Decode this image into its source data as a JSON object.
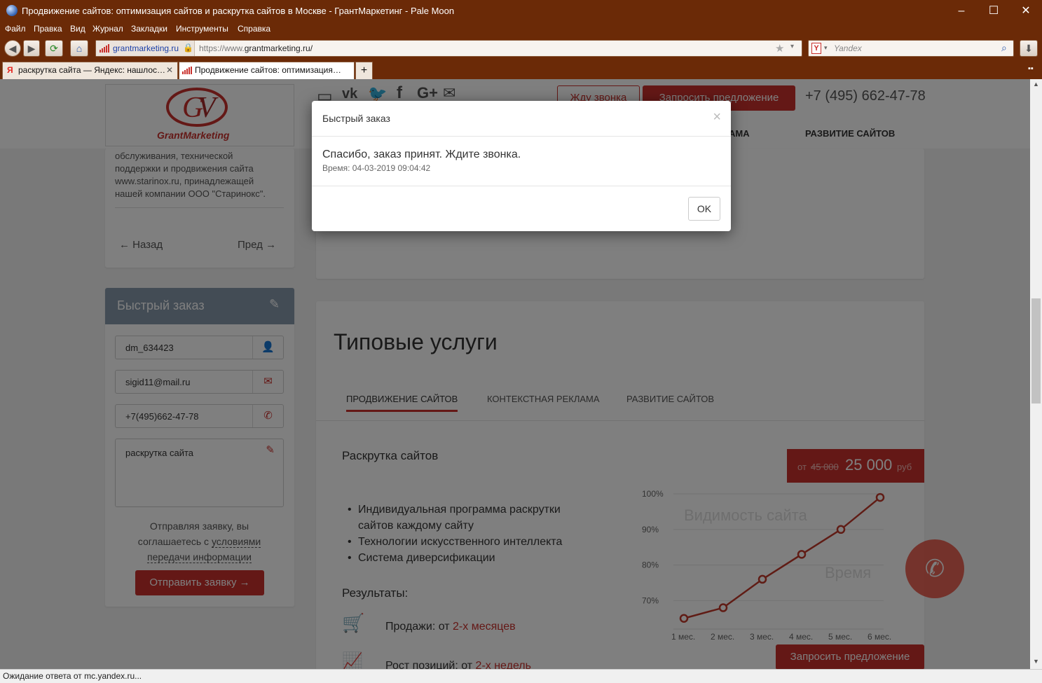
{
  "window": {
    "title": "Продвижение сайтов: оптимизация сайтов и раскрутка сайтов в Москве - ГрантМаркетинг - Pale Moon"
  },
  "menu": [
    "Файл",
    "Правка",
    "Вид",
    "Журнал",
    "Закладки",
    "Инструменты",
    "Справка"
  ],
  "nav": {
    "site_identity": "grantmarketing.ru",
    "url_prefix": "https://www.",
    "url_main": "grantmarketing.ru/",
    "search_placeholder": "Yandex"
  },
  "tabs": [
    {
      "label": "раскрутка сайта — Яндекс: нашлос…",
      "active": false
    },
    {
      "label": "Продвижение сайтов: оптимизация…",
      "active": true
    }
  ],
  "header": {
    "logo_text": "GrantMarketing",
    "callback_label": "Жду звонка",
    "request_label": "Запросить предложение",
    "phone": "+7 (495) 662-47-78",
    "nav_items": [
      "АМА",
      "РАЗВИТИЕ САЙТОВ"
    ]
  },
  "sidebar": {
    "case_text": [
      "обслуживания, технической",
      "поддержки и продвижения сайта",
      "www.starinox.ru, принадлежащей",
      "нашей компании ООО \"Старинокс\"."
    ],
    "prev_label": "Назад",
    "next_label": "Пред",
    "quick_order": {
      "title": "Быстрый заказ",
      "name_value": "dm_634423",
      "email_value": "sigid11@mail.ru",
      "phone_value": "+7(495)662-47-78",
      "message_value": "раскрутка сайта",
      "consent_line1": "Отправляя заявку, вы",
      "consent_line2_plain": "соглашаетесь с ",
      "consent_link1": "условиями",
      "consent_link2": "передачи информации",
      "submit_label": "Отправить заявку"
    }
  },
  "services": {
    "title": "Типовые услуги",
    "tabs": [
      "ПРОДВИЖЕНИЕ САЙТОВ",
      "КОНТЕКСТНАЯ РЕКЛАМА",
      "РАЗВИТИЕ САЙТОВ"
    ],
    "item_title": "Раскрутка сайтов",
    "price_from": "от",
    "price_old": "45 000",
    "price_new": "25 000",
    "price_currency": "руб",
    "bullets": [
      "Индивидуальная программа раскрутки",
      "сайтов каждому сайту",
      "Технологии искусственного интеллекта",
      "Система диверсификации"
    ],
    "results_title": "Результаты:",
    "result1_prefix": "Продажи: от ",
    "result1_link": "2-х месяцев",
    "result2_prefix": "Рост позиций: от ",
    "result2_link": "2-х недель",
    "request_label": "Запросить предложение"
  },
  "chart_data": {
    "type": "line",
    "categories": [
      "1 мес.",
      "2 мес.",
      "3 мес.",
      "4 мес.",
      "5 мес.",
      "6 мес."
    ],
    "values": [
      65,
      68,
      76,
      83,
      90,
      99
    ],
    "yticks": [
      "100%",
      "90%",
      "80%",
      "70%"
    ],
    "ylim": [
      62,
      100
    ],
    "ylabel": "Видимость сайта",
    "xlabel": "Время",
    "color": "#c0392b"
  },
  "modal": {
    "title": "Быстрый заказ",
    "close": "×",
    "message": "Спасибо, заказ принят. Ждите звонка.",
    "datetime": "Время: 04-03-2019 09:04:42",
    "ok_label": "OK"
  },
  "status": {
    "text": "Ожидание ответа от mc.yandex.ru..."
  }
}
